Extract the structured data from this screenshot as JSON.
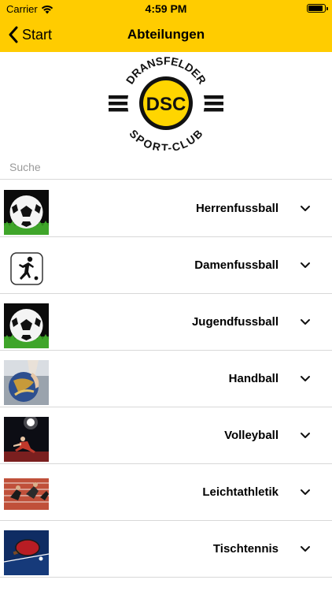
{
  "status": {
    "carrier": "Carrier",
    "time": "4:59 PM",
    "battery_level": 0.9
  },
  "nav": {
    "back_label": "Start",
    "title": "Abteilungen"
  },
  "logo": {
    "top_text": "DRANSFELDER",
    "monogram": "DSC",
    "bottom_text": "SPORT-CLUB"
  },
  "search": {
    "placeholder": "Suche",
    "value": ""
  },
  "departments": [
    {
      "label": "Herrenfussball",
      "image": "soccer-ball"
    },
    {
      "label": "Damenfussball",
      "image": "soccer-player-pictogram"
    },
    {
      "label": "Jugendfussball",
      "image": "soccer-ball"
    },
    {
      "label": "Handball",
      "image": "handball"
    },
    {
      "label": "Volleyball",
      "image": "volleyball"
    },
    {
      "label": "Leichtathletik",
      "image": "athletics-track"
    },
    {
      "label": "Tischtennis",
      "image": "table-tennis-paddle"
    }
  ],
  "colors": {
    "accent": "#ffcc00",
    "logo_yellow": "#ffd500",
    "separator": "#d8d8d8"
  }
}
